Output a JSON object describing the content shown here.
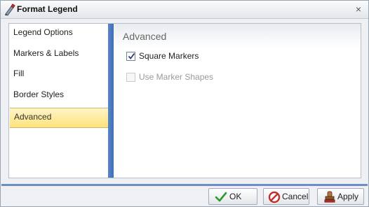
{
  "window": {
    "title": "Format Legend",
    "close_glyph": "×",
    "icon": "format-legend-icon"
  },
  "sidebar": {
    "items": [
      {
        "label": "Legend Options",
        "active": false
      },
      {
        "label": "Markers & Labels",
        "active": false
      },
      {
        "label": "Fill",
        "active": false
      },
      {
        "label": "Border Styles",
        "active": false
      },
      {
        "label": "Advanced",
        "active": true
      }
    ]
  },
  "panel": {
    "title": "Advanced",
    "options": [
      {
        "label": "Square Markers",
        "checked": true,
        "enabled": true
      },
      {
        "label": "Use Marker Shapes",
        "checked": false,
        "enabled": false
      }
    ]
  },
  "footer": {
    "ok_label": "OK",
    "cancel_label": "Cancel",
    "apply_label": "Apply"
  },
  "colors": {
    "accent_bar": "#3f6fb8",
    "active_item": "#ffe27a",
    "ok_icon": "#2e9a2e",
    "cancel_icon": "#c0302a"
  }
}
